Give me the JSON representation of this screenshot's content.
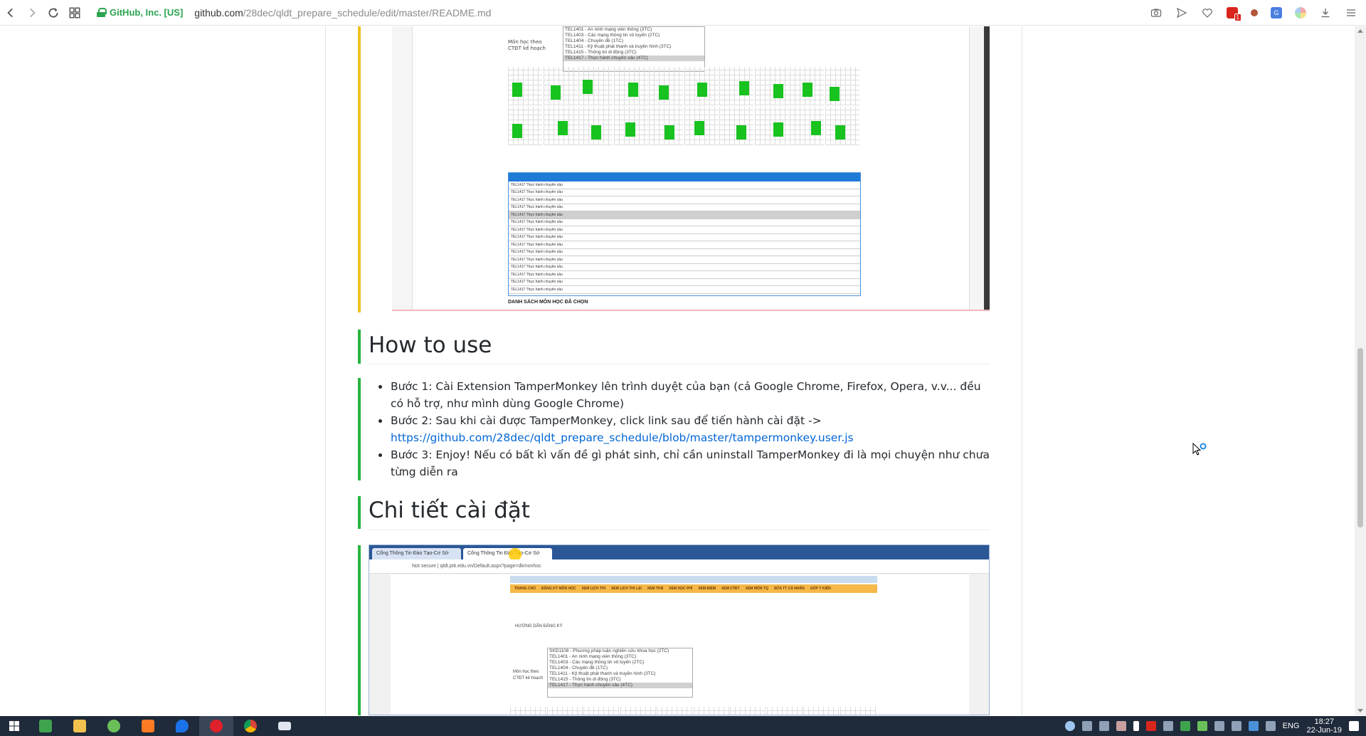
{
  "browser": {
    "secure_label": "GitHub, Inc. [US]",
    "url_host": "github.com",
    "url_path": "/28dec/qldt_prepare_schedule/edit/master/README.md",
    "extension_badge": "1"
  },
  "readme": {
    "how_to_use_heading": "How to use",
    "steps": [
      {
        "text": "Bước 1: Cài Extension TamperMonkey lên trình duyệt của bạn (cả Google Chrome, Firefox, Opera, v.v... đều có hỗ trợ, như mình dùng Google Chrome)"
      },
      {
        "text": "Bước 2: Sau khi cài được TamperMonkey, click link sau để tiến hành cài đặt ->",
        "link": "https://github.com/28dec/qldt_prepare_schedule/blob/master/tampermonkey.user.js"
      },
      {
        "text": "Bước 3: Enjoy! Nếu có bất kì vấn đề gì phát sinh, chỉ cần uninstall TamperMonkey đi là mọi chuyện như chưa từng diễn ra"
      }
    ],
    "install_heading": "Chi tiết cài đặt"
  },
  "screenshot1": {
    "label_line1": "Môn học theo",
    "label_line2": "CTĐT kế hoạch",
    "course_list": [
      "TEL1401 - An ninh mạng viễn thông (3TC)",
      "TEL1403 - Các mạng thông tin vô tuyến (2TC)",
      "TEL1404 - Chuyên đề (1TC)",
      "TEL1411 - Kỹ thuật phát thanh và truyền hình (3TC)",
      "TEL1415 - Thông tin di động (3TC)",
      "TEL1417 - Thực hành chuyên sâu (4TC)"
    ],
    "selected_course_index": 5,
    "table_rows": [
      "TEL1417 Thực hành chuyên sâu",
      "TEL1417 Thực hành chuyên sâu",
      "TEL1417 Thực hành chuyên sâu",
      "TEL1417 Thực hành chuyên sâu",
      "TEL1417 Thực hành chuyên sâu",
      "TEL1417 Thực hành chuyên sâu",
      "TEL1417 Thực hành chuyên sâu",
      "TEL1417 Thực hành chuyên sâu",
      "TEL1417 Thực hành chuyên sâu",
      "TEL1417 Thực hành chuyên sâu",
      "TEL1417 Thực hành chuyên sâu",
      "TEL1417 Thực hành chuyên sâu",
      "TEL1417 Thực hành chuyên sâu",
      "TEL1417 Thực hành chuyên sâu",
      "TEL1417 Thực hành chuyên sâu"
    ],
    "highlighted_row_index": 4,
    "footer": "DANH SÁCH MÔN HỌC ĐÃ CHỌN"
  },
  "screenshot2": {
    "tab1": "Cổng Thông Tin Đào Tạo-Cơ Sở",
    "tab2": "Cổng Thông Tin Đào Tạo-Cơ Sở",
    "address": "Not secure | qldt.ptit.edu.vn/Default.aspx?page=dkmonhoc",
    "menu": [
      "TRANG CHỦ",
      "ĐĂNG KÝ MÔN HỌC",
      "XEM LỊCH THI",
      "XEM LỊCH THI LẠI",
      "XEM TKB",
      "XEM HỌC PHÍ",
      "XEM ĐIỂM",
      "XEM CTĐT",
      "XEM MÔN TQ",
      "SỬA TT CÁ NHÂN",
      "GÓP Ý KIẾN"
    ],
    "guide_label": "HƯỚNG DẪN ĐĂNG KÝ",
    "label_line1": "Môn học theo",
    "label_line2": "CTĐT kế hoạch",
    "course_list": [
      "SKD1108 - Phương pháp luận nghiên cứu khoa học (2TC)",
      "TEL1401 - An ninh mạng viễn thông (3TC)",
      "TEL1403 - Các mạng thông tin vô tuyến (2TC)",
      "TEL1404 - Chuyên đề (1TC)",
      "TEL1411 - Kỹ thuật phát thanh và truyền hình (3TC)",
      "TEL1415 - Thông tin di động (3TC)",
      "TEL1417 - Thực hành chuyên sâu (4TC)"
    ],
    "selected_course_index": 6
  },
  "taskbar": {
    "lang": "ENG",
    "time": "18:27",
    "date": "22-Jun-19"
  },
  "colors": {
    "accent_yellow": "#f0c020",
    "accent_green": "#28b43c",
    "link": "#0366d6",
    "secure_green": "#2aa44f"
  }
}
